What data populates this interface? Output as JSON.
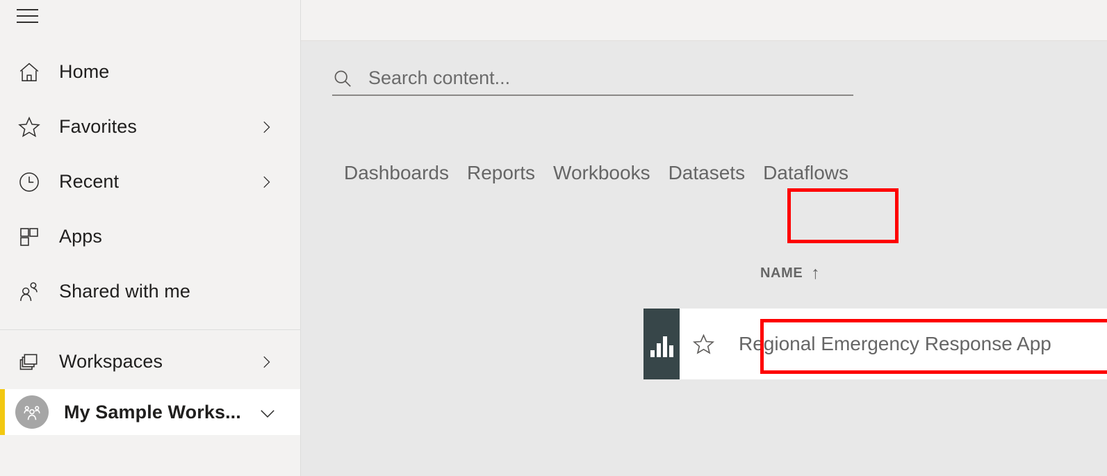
{
  "sidebar": {
    "menu_button": "hamburger-menu",
    "items": [
      {
        "label": "Home",
        "icon": "home-icon",
        "chevron": false
      },
      {
        "label": "Favorites",
        "icon": "star-icon",
        "chevron": true
      },
      {
        "label": "Recent",
        "icon": "clock-icon",
        "chevron": true
      },
      {
        "label": "Apps",
        "icon": "apps-grid-icon",
        "chevron": false
      },
      {
        "label": "Shared with me",
        "icon": "shared-people-icon",
        "chevron": false
      }
    ],
    "workspaces": {
      "label": "Workspaces",
      "icon": "stacked-windows-icon",
      "chevron": true
    },
    "selected_workspace": {
      "label": "My Sample Works...",
      "avatar_icon": "group-people-icon",
      "chevron": "chevron-down-icon",
      "accent_color": "#f2c811",
      "avatar_color": "#a6a6a6"
    }
  },
  "search": {
    "placeholder": "Search content...",
    "value": "",
    "icon": "search-icon"
  },
  "tabs": [
    {
      "label": "Dashboards",
      "highlighted": false
    },
    {
      "label": "Reports",
      "highlighted": true
    },
    {
      "label": "Workbooks",
      "highlighted": false
    },
    {
      "label": "Datasets",
      "highlighted": false
    },
    {
      "label": "Dataflows",
      "highlighted": false
    }
  ],
  "table": {
    "columns": [
      {
        "label": "NAME",
        "sort": "↑"
      }
    ],
    "rows": [
      {
        "thumb_icon": "bar-chart-report-icon",
        "thumb_color": "#374649",
        "favorite_icon": "star-outline-icon",
        "name": "Regional Emergency Response App",
        "highlighted": true
      }
    ]
  },
  "highlight_color": "#fe0000"
}
